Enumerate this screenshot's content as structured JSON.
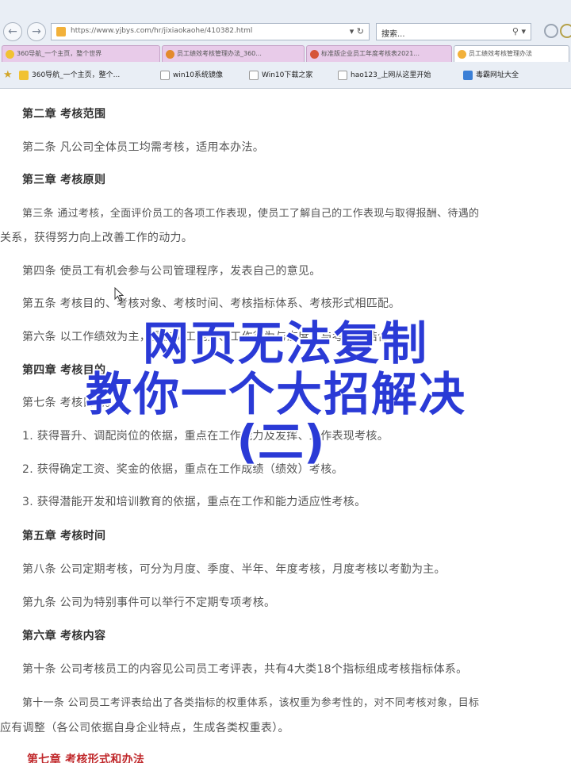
{
  "browser": {
    "url": "https://www.yjbys.com/hr/jixiaokaohe/410382.html",
    "search_placeholder": "搜索...",
    "tabs": [
      {
        "label": "360导航_一个主页，整个世界"
      },
      {
        "label": "员工绩效考核管理办法_360..."
      },
      {
        "label": "标准版企业员工年度考核表2021..."
      },
      {
        "label": "员工绩效考核管理办法"
      }
    ],
    "favorites": [
      {
        "label": "360导航_一个主页，整个..."
      },
      {
        "label": "win10系统镜像"
      },
      {
        "label": "Win10下载之家"
      },
      {
        "label": "hao123_上网从这里开始"
      },
      {
        "label": "毒霸网址大全"
      }
    ]
  },
  "document": {
    "lines": [
      {
        "text": "第二章  考核范围",
        "style": "heading"
      },
      {
        "text": "第二条  凡公司全体员工均需考核，适用本办法。",
        "style": "body"
      },
      {
        "text": "第三章  考核原则",
        "style": "heading"
      },
      {
        "text": "第三条  通过考核，全面评价员工的各项工作表现，使员工了解自己的工作表现与取得报酬、待遇的",
        "style": "body"
      },
      {
        "text": "关系，获得努力向上改善工作的动力。",
        "style": "body"
      },
      {
        "text": "第四条  使员工有机会参与公司管理程序，发表自己的意见。",
        "style": "body"
      },
      {
        "text": "第五条  考核目的、考核对象、考核时间、考核指标体系、考核形式相匹配。",
        "style": "body"
      },
      {
        "text": "第六条  以工作绩效为主，重在员工能力、工作行为与态度，与考核相结合。",
        "style": "body"
      },
      {
        "text": "第四章  考核目的",
        "style": "heading"
      },
      {
        "text": "第七条  考核目的。",
        "style": "body"
      },
      {
        "text": "1.  获得晋升、调配岗位的依据，重点在工作能力及发挥、工作表现考核。",
        "style": "body"
      },
      {
        "text": "2.  获得确定工资、奖金的依据，重点在工作成绩（绩效）考核。",
        "style": "body"
      },
      {
        "text": "3.  获得潜能开发和培训教育的依据，重点在工作和能力适应性考核。",
        "style": "body"
      },
      {
        "text": "第五章  考核时间",
        "style": "heading"
      },
      {
        "text": "第八条  公司定期考核，可分为月度、季度、半年、年度考核，月度考核以考勤为主。",
        "style": "body"
      },
      {
        "text": "第九条  公司为特别事件可以举行不定期专项考核。",
        "style": "body"
      },
      {
        "text": "第六章  考核内容",
        "style": "heading"
      },
      {
        "text": "第十条  公司考核员工的内容见公司员工考评表，共有4大类18个指标组成考核指标体系。",
        "style": "body"
      },
      {
        "text": "第十一条  公司员工考评表给出了各类指标的权重体系，该权重为参考性的，对不同考核对象，目标",
        "style": "body"
      },
      {
        "text": "应有调整（各公司依据自身企业特点，生成各类权重表）。",
        "style": "body"
      },
      {
        "text": "第七章  考核形式和办法",
        "style": "heading-red"
      }
    ]
  },
  "overlay": {
    "line1": "网页无法复制",
    "line2": "教你一个大招解决",
    "line3": "(二)"
  },
  "colors": {
    "overlay_text": "#2a3ad6",
    "heading_red": "#c0282b",
    "tab_bg": "#e8cbe9"
  }
}
